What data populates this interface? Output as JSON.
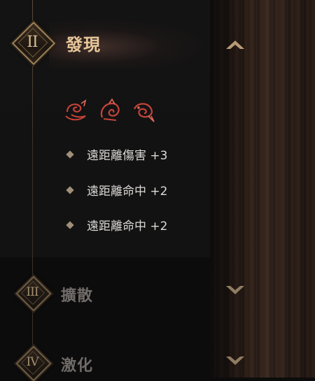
{
  "sections": [
    {
      "numeral": "II",
      "title": "發現",
      "expanded": true
    },
    {
      "numeral": "III",
      "title": "擴散",
      "expanded": false
    },
    {
      "numeral": "IV",
      "title": "激化",
      "expanded": false
    }
  ],
  "effects": [
    {
      "icon": "serpent-rune-icon"
    },
    {
      "icon": "beast-rune-icon"
    },
    {
      "icon": "fish-rune-icon"
    }
  ],
  "stats": [
    {
      "label": "遠距離傷害 +3"
    },
    {
      "label": "遠距離命中 +2"
    },
    {
      "label": "遠距離命中 +2"
    }
  ],
  "colors": {
    "accent_gold": "#e8c79a",
    "rune_red": "#c4433a",
    "dim_text": "#6f6b68"
  }
}
